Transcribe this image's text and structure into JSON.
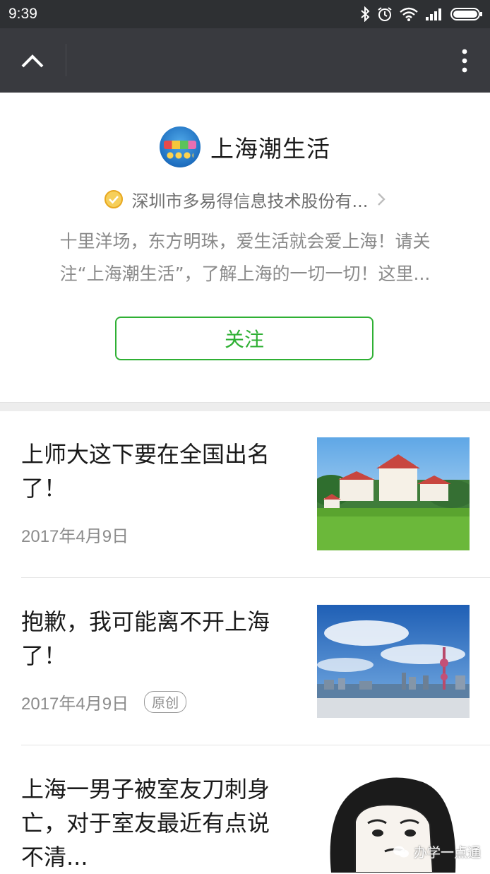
{
  "status_bar": {
    "time": "9:39",
    "icons": [
      "bluetooth-icon",
      "alarm-icon",
      "wifi-icon",
      "signal-icon",
      "battery-icon"
    ]
  },
  "nav": {
    "back_icon": "chevron-up-icon",
    "more_icon": "more-vertical-icon"
  },
  "account": {
    "name": "上海潮生活",
    "verified_by": "深圳市多易得信息技术股份有...",
    "description_line1": "十里洋场，东方明珠，爱生活就会爱上海！请关",
    "description_line2": "注“上海潮生活”，了解上海的一切一切！这里...",
    "follow_label": "关注"
  },
  "articles": [
    {
      "title_line1": "上师大这下要在全国出名",
      "title_line2": "了！",
      "date": "2017年4月9日",
      "tag": ""
    },
    {
      "title_line1": "抱歉，我可能离不开上海",
      "title_line2": "了！",
      "date": "2017年4月9日",
      "tag": "原创"
    },
    {
      "title_line1": "上海一男子被室友刀刺身",
      "title_line2": "亡，对于室友最近有点说",
      "title_line3": "不清..."
    }
  ],
  "watermark": "办学一点通",
  "colors": {
    "nav_bg": "#393a3f",
    "status_bg": "#2e3033",
    "accent_green": "#2fb034",
    "verify_badge": "#f0b429"
  }
}
